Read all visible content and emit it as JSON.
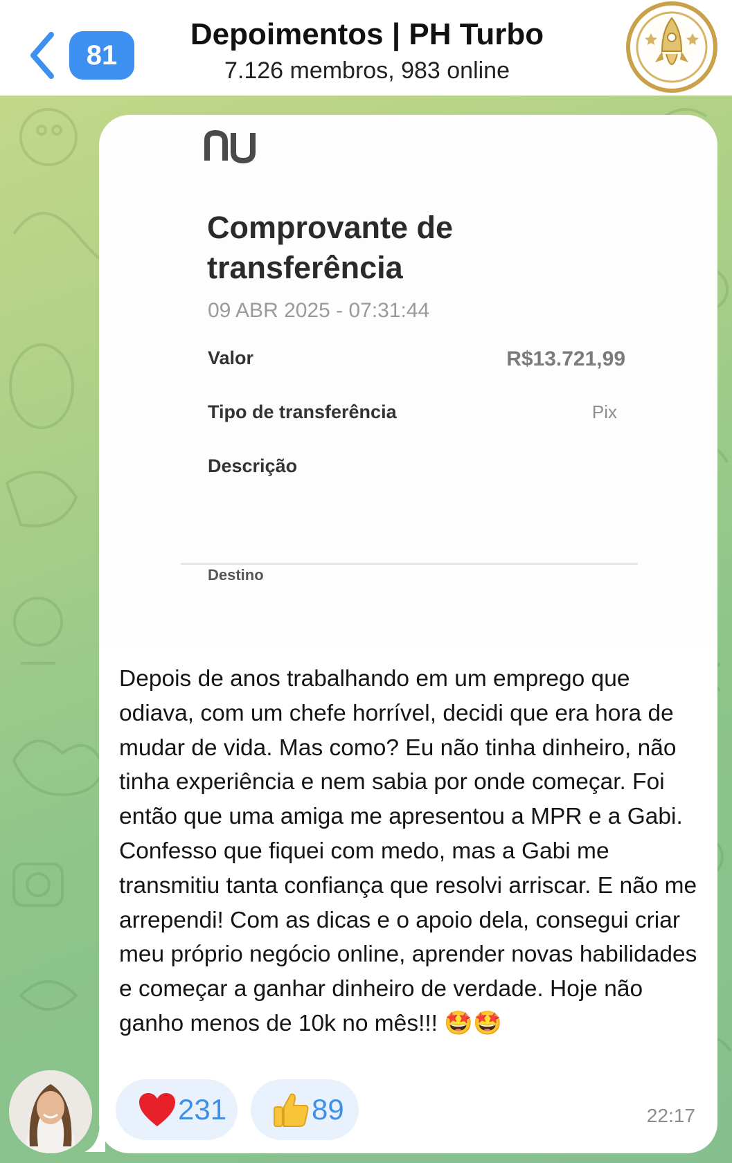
{
  "header": {
    "back_icon": "chevron-left-icon",
    "unread_count": "81",
    "title": "Depoimentos | PH Turbo",
    "subtitle": "7.126 membros, 983 online",
    "avatar_icon": "rocket-logo-icon"
  },
  "receipt": {
    "logo_text": "nu",
    "title": "Comprovante de transferência",
    "date": "09 ABR 2025 - 07:31:44",
    "rows": [
      {
        "label": "Valor",
        "value": "R$13.721,99"
      },
      {
        "label": "Tipo de transferência",
        "value": "Pix"
      },
      {
        "label": "Descrição",
        "value": ""
      }
    ],
    "section": "Destino"
  },
  "message": {
    "text": "Depois de anos trabalhando em um emprego que odiava, com um chefe horrível, decidi que era hora de mudar de vida. Mas como? Eu não tinha dinheiro, não tinha experiência e nem sabia por onde começar. Foi então que uma amiga me apresentou a MPR e a Gabi. Confesso que fiquei com medo, mas a Gabi me transmitiu tanta confiança que resolvi arriscar. E não me arrependi! Com as dicas e o apoio dela, consegui criar meu próprio negócio online, aprender novas habilidades e começar a ganhar dinheiro de verdade. Hoje não ganho menos de 10k no mês!!! 🤩🤩",
    "time": "22:17",
    "reactions": [
      {
        "icon": "heart-icon",
        "count": "231"
      },
      {
        "icon": "thumbs-up-icon",
        "count": "89"
      }
    ]
  },
  "colors": {
    "accent": "#3d8ff0",
    "reaction_bg": "#e9f2fc",
    "reaction_count": "#3f8fe6",
    "gold": "#c9a14a"
  }
}
